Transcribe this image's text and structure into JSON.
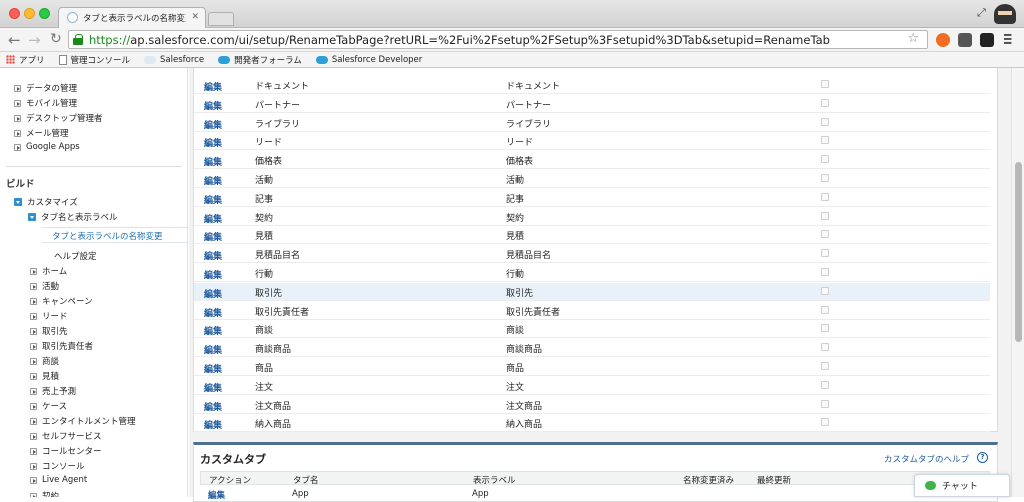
{
  "browser": {
    "tab_title": "タブと表示ラベルの名称変更",
    "url_scheme": "https://",
    "url_rest": "ap.salesforce.com/ui/setup/RenameTabPage?retURL=%2Fui%2Fsetup%2FSetup%3Fsetupid%3DTab&setupid=RenameTab",
    "bookmarks": [
      "アプリ",
      "管理コンソール",
      "Salesforce",
      "開発者フォーラム",
      "Salesforce Developer"
    ]
  },
  "sidebar": {
    "top_items": [
      "データの管理",
      "モバイル管理",
      "デスクトップ管理者",
      "メール管理",
      "Google Apps"
    ],
    "section_build": "ビルド",
    "customize": "カスタマイズ",
    "tabs_labels": "タブ名と表示ラベル",
    "selected": "タブと表示ラベルの名称変更",
    "help_settings": "ヘルプ設定",
    "objects": [
      "ホーム",
      "活動",
      "キャンペーン",
      "リード",
      "取引先",
      "取引先責任者",
      "商談",
      "見積",
      "売上予測",
      "ケース",
      "エンタイトルメント管理",
      "セルフサービス",
      "コールセンター",
      "コンソール",
      "Live Agent",
      "契約"
    ]
  },
  "standard_tabs": {
    "edit_label": "編集",
    "rows": [
      {
        "tab": "ドキュメント",
        "label": "ドキュメント"
      },
      {
        "tab": "パートナー",
        "label": "パートナー"
      },
      {
        "tab": "ライブラリ",
        "label": "ライブラリ"
      },
      {
        "tab": "リード",
        "label": "リード"
      },
      {
        "tab": "価格表",
        "label": "価格表"
      },
      {
        "tab": "活動",
        "label": "活動"
      },
      {
        "tab": "記事",
        "label": "記事"
      },
      {
        "tab": "契約",
        "label": "契約"
      },
      {
        "tab": "見積",
        "label": "見積"
      },
      {
        "tab": "見積品目名",
        "label": "見積品目名"
      },
      {
        "tab": "行動",
        "label": "行動"
      },
      {
        "tab": "取引先",
        "label": "取引先"
      },
      {
        "tab": "取引先責任者",
        "label": "取引先責任者"
      },
      {
        "tab": "商談",
        "label": "商談"
      },
      {
        "tab": "商談商品",
        "label": "商談商品"
      },
      {
        "tab": "商品",
        "label": "商品"
      },
      {
        "tab": "注文",
        "label": "注文"
      },
      {
        "tab": "注文商品",
        "label": "注文商品"
      },
      {
        "tab": "納入商品",
        "label": "納入商品"
      }
    ]
  },
  "custom_tabs": {
    "title": "カスタムタブ",
    "help_link": "カスタムタブのヘルプ",
    "columns": [
      "アクション",
      "タブ名",
      "表示ラベル",
      "名称変更済み",
      "最終更新"
    ],
    "first_row": {
      "action": "編集",
      "tab": "App",
      "label": "App"
    }
  },
  "chat": {
    "label": "チャット"
  }
}
